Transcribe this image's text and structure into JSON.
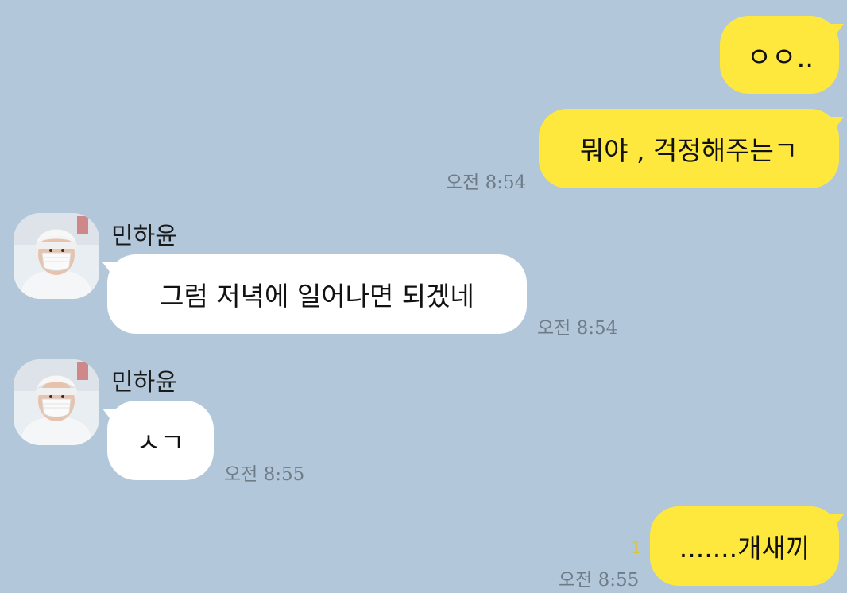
{
  "messages": [
    {
      "from": "me",
      "text": "ㅇㅇ.."
    },
    {
      "from": "me",
      "text": "뭐야 , 걱정해주는ㄱ",
      "time": "오전 8:54"
    },
    {
      "from": "other",
      "sender": "민하윤",
      "text": "그럼 저녁에 일어나면 되겠네",
      "time": "오전 8:54"
    },
    {
      "from": "other",
      "sender": "민하윤",
      "text": "ㅅㄱ",
      "time": "오전 8:55"
    },
    {
      "from": "me",
      "text": ".......개새끼",
      "time": "오전 8:55",
      "unread": "1"
    }
  ],
  "avatar_icon": "profile-photo-white-beanie-mask",
  "colors": {
    "background": "#b2c7da",
    "my_bubble": "#fee83d",
    "other_bubble": "#ffffff",
    "unread": "#e1c327"
  }
}
